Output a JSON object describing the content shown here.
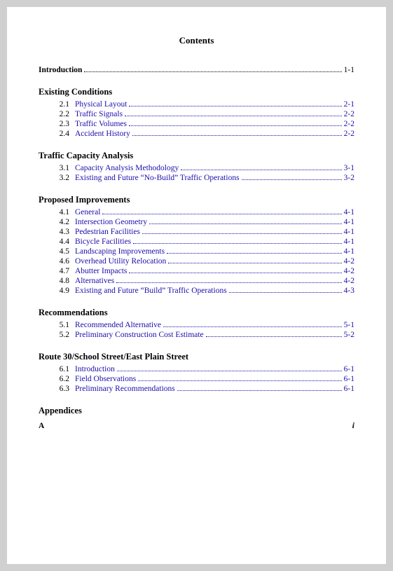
{
  "title": "Contents",
  "intro": {
    "label": "Introduction",
    "dots": "...",
    "page": "1-1"
  },
  "sections": [
    {
      "heading": "Existing Conditions",
      "items": [
        {
          "num": "2.1",
          "label": "Physical Layout",
          "page": "2-1"
        },
        {
          "num": "2.2",
          "label": "Traffic Signals",
          "page": "2-2"
        },
        {
          "num": "2.3",
          "label": "Traffic Volumes",
          "page": "2-2"
        },
        {
          "num": "2.4",
          "label": "Accident History",
          "page": "2-2"
        }
      ]
    },
    {
      "heading": "Traffic Capacity Analysis",
      "items": [
        {
          "num": "3.1",
          "label": "Capacity Analysis Methodology",
          "page": "3-1"
        },
        {
          "num": "3.2",
          "label": "Existing and Future “No-Build” Traffic Operations",
          "page": "3-2"
        }
      ]
    },
    {
      "heading": "Proposed Improvements",
      "items": [
        {
          "num": "4.1",
          "label": "General",
          "page": "4-1"
        },
        {
          "num": "4.2",
          "label": "Intersection Geometry",
          "page": "4-1"
        },
        {
          "num": "4.3",
          "label": "Pedestrian Facilities",
          "page": "4-1"
        },
        {
          "num": "4.4",
          "label": "Bicycle Facilities",
          "page": "4-1"
        },
        {
          "num": "4.5",
          "label": "Landscaping Improvements",
          "page": "4-1"
        },
        {
          "num": "4.6",
          "label": "Overhead Utility Relocation",
          "page": "4-2"
        },
        {
          "num": "4.7",
          "label": "Abutter Impacts",
          "page": "4-2"
        },
        {
          "num": "4.8",
          "label": "Alternatives",
          "page": "4-2"
        },
        {
          "num": "4.9",
          "label": "Existing and Future “Build” Traffic Operations",
          "page": "4-3"
        }
      ]
    },
    {
      "heading": "Recommendations",
      "items": [
        {
          "num": "5.1",
          "label": "Recommended Alternative",
          "page": "5-1"
        },
        {
          "num": "5.2",
          "label": "Preliminary Construction Cost Estimate",
          "page": "5-2"
        }
      ]
    },
    {
      "heading": "Route 30/School Street/East Plain Street",
      "items": [
        {
          "num": "6.1",
          "label": "Introduction",
          "page": "6-1"
        },
        {
          "num": "6.2",
          "label": "Field Observations",
          "page": "6-1"
        },
        {
          "num": "6.3",
          "label": "Preliminary Recommendations",
          "page": "6-1"
        }
      ]
    }
  ],
  "appendices_heading": "Appendices",
  "footer": {
    "label": "A",
    "page": "i"
  }
}
